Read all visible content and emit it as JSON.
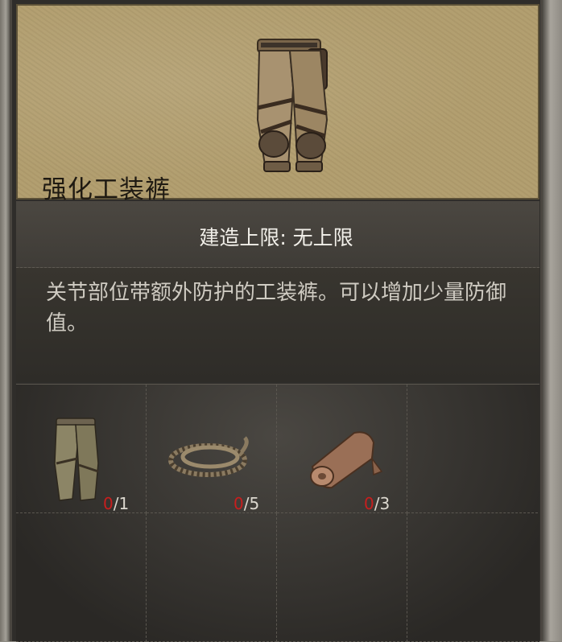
{
  "item": {
    "name": "强化工装裤",
    "build_limit": "建造上限: 无上限",
    "description": "关节部位带额外防护的工装裤。可以增加少量防御值。",
    "image": "reinforced-cargo-pants-icon"
  },
  "materials": [
    {
      "icon": "cargo-pants-icon",
      "have": "0",
      "need": "/1"
    },
    {
      "icon": "rope-icon",
      "have": "0",
      "need": "/5"
    },
    {
      "icon": "cloth-roll-icon",
      "have": "0",
      "need": "/3"
    }
  ],
  "colors": {
    "header_bg": "#b19d6d",
    "panel_bg": "#2f2d2a",
    "count_have": "#c81e1e"
  }
}
